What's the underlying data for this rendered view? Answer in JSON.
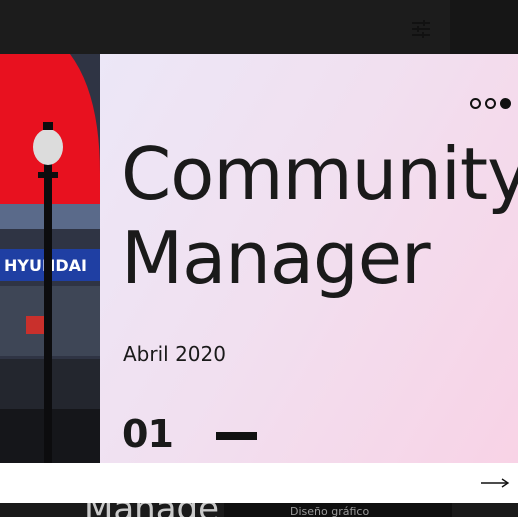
{
  "header": {
    "filter_icon": "sliders-icon"
  },
  "card": {
    "title_line1": "Community",
    "title_line2": "Manager",
    "date": "Abril 2020",
    "index": "01",
    "menu_icon": "dots-menu-icon",
    "colors": {
      "gradient_start": "#ece7f7",
      "gradient_end": "#f8d3e6",
      "text": "#1a1a1a"
    }
  },
  "photo": {
    "description": "Street photo with lamp post and Hyundai billboard",
    "sign_text": "HYUNDAI"
  },
  "footer": {
    "next_icon": "arrow-right-icon"
  },
  "below": {
    "ghost_title": "Manage",
    "panel_text": "Diseño gráfico"
  }
}
